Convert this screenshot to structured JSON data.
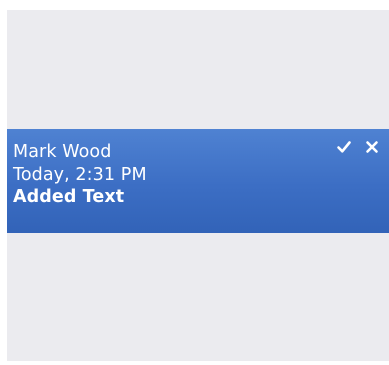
{
  "comment": {
    "author": "Mark Wood",
    "timestamp": "Today, 2:31 PM",
    "action": "Added Text"
  },
  "colors": {
    "background": "#ebebef",
    "highlight": "#3c6ec4",
    "text": "#ffffff"
  },
  "icons": {
    "accept": "checkmark-icon",
    "reject": "close-icon"
  }
}
